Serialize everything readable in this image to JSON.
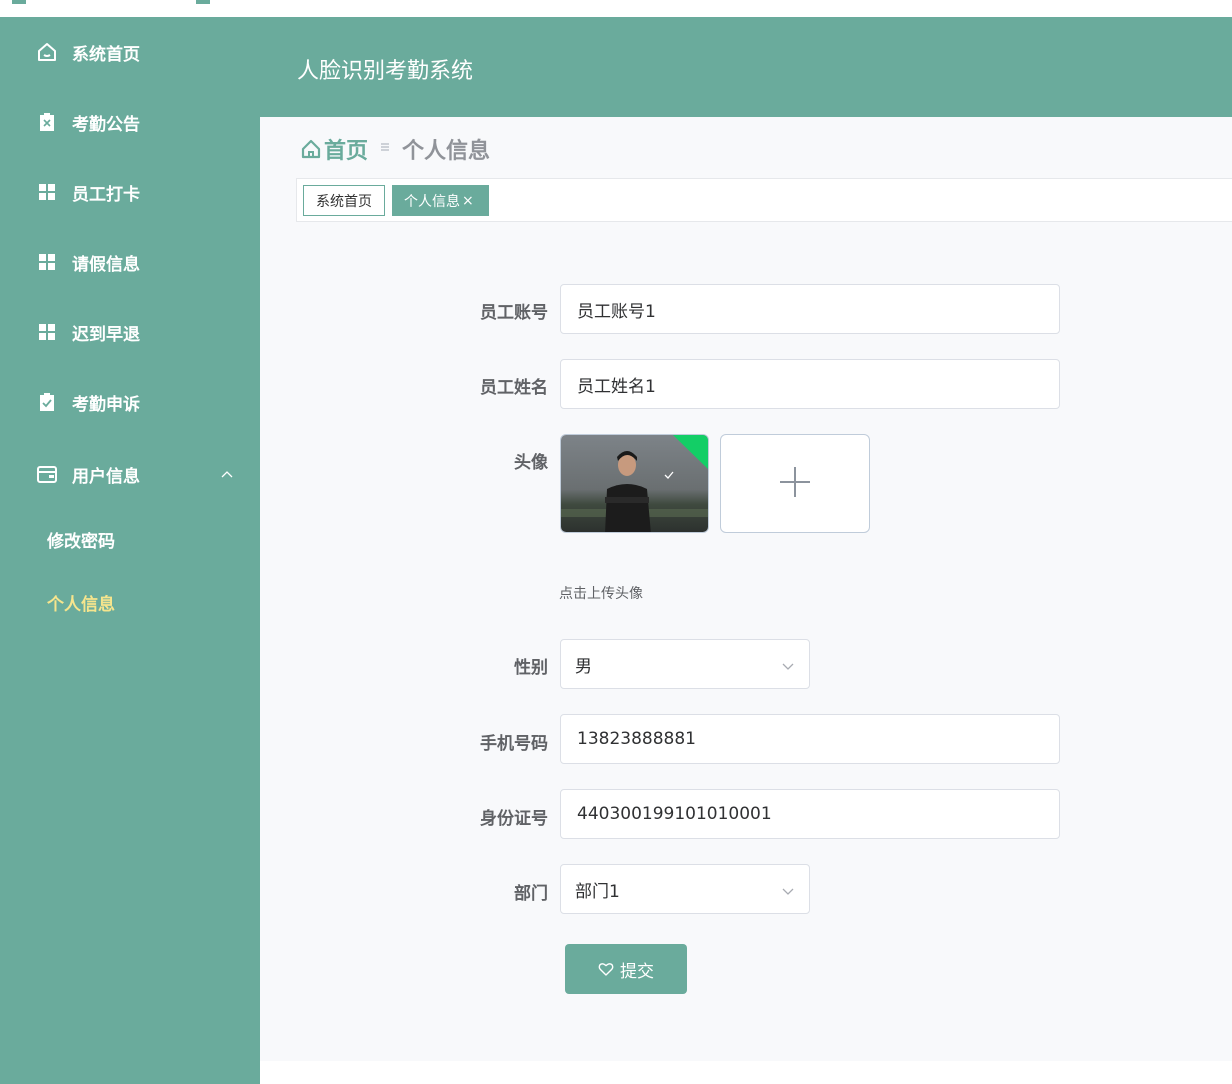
{
  "app": {
    "title": "人脸识别考勤系统"
  },
  "sidebar": {
    "items": [
      {
        "label": "系统首页",
        "icon": "home-icon"
      },
      {
        "label": "考勤公告",
        "icon": "clipboard-x-icon"
      },
      {
        "label": "员工打卡",
        "icon": "grid-icon"
      },
      {
        "label": "请假信息",
        "icon": "grid-icon"
      },
      {
        "label": "迟到早退",
        "icon": "grid-icon"
      },
      {
        "label": "考勤申诉",
        "icon": "clipboard-check-icon"
      },
      {
        "label": "用户信息",
        "icon": "wallet-icon",
        "expanded": true
      }
    ],
    "submenu": [
      {
        "label": "修改密码",
        "active": false
      },
      {
        "label": "个人信息",
        "active": true
      }
    ],
    "active_color": "#f6e58d"
  },
  "breadcrumb": {
    "home": "首页",
    "current": "个人信息"
  },
  "tags": [
    {
      "label": "系统首页",
      "active": false
    },
    {
      "label": "个人信息",
      "active": true,
      "close": "×"
    }
  ],
  "form": {
    "account": {
      "label": "员工账号",
      "value": "员工账号1"
    },
    "name": {
      "label": "员工姓名",
      "value": "员工姓名1"
    },
    "avatar": {
      "label": "头像",
      "tip": "点击上传头像",
      "upload_symbol": "+"
    },
    "gender": {
      "label": "性别",
      "value": "男"
    },
    "phone": {
      "label": "手机号码",
      "value": "13823888881"
    },
    "id_card": {
      "label": "身份证号",
      "value": "440300199101010001"
    },
    "department": {
      "label": "部门",
      "value": "部门1"
    },
    "submit": {
      "label": "提交"
    }
  },
  "colors": {
    "primary": "#6aab9c",
    "content_bg": "#f8f9fb",
    "upload_success": "#13ce66"
  }
}
